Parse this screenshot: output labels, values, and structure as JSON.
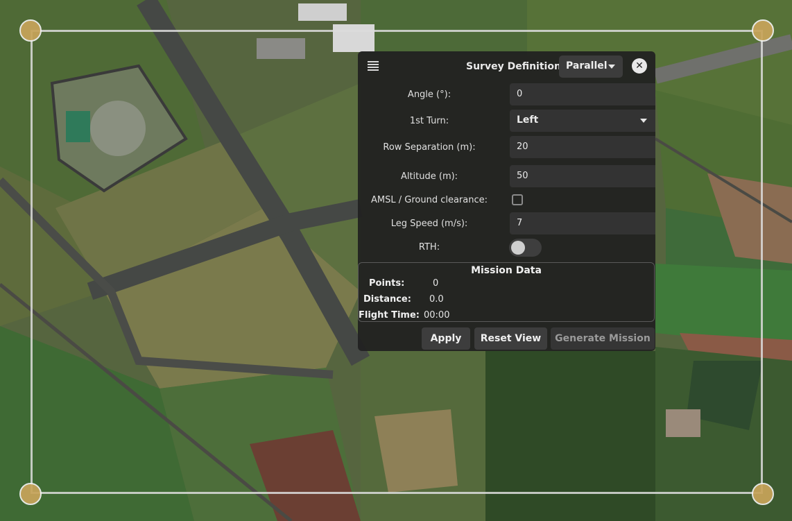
{
  "panel": {
    "title": "Survey Definition",
    "pattern_value": "Parallel",
    "close_glyph": "✕",
    "fields": {
      "angle_label": "Angle (°):",
      "angle_value": "0",
      "first_turn_label": "1st Turn:",
      "first_turn_value": "Left",
      "row_sep_label": "Row Separation (m):",
      "row_sep_value": "20",
      "altitude_label": "Altitude (m):",
      "altitude_value": "50",
      "amsl_label": "AMSL / Ground clearance:",
      "amsl_checked": false,
      "leg_speed_label": "Leg Speed (m/s):",
      "leg_speed_value": "7",
      "rth_label": "RTH:",
      "rth_on": false
    },
    "mission_data": {
      "title": "Mission Data",
      "points_label": "Points:",
      "points_value": "0",
      "distance_label": "Distance:",
      "distance_value": "0.0",
      "flight_time_label": "Flight Time:",
      "flight_time_value": "00:00"
    },
    "buttons": {
      "apply": "Apply",
      "reset_view": "Reset View",
      "generate_mission": "Generate Mission"
    }
  },
  "icons": {
    "menu": "menu-icon",
    "close": "close-icon",
    "dropdown": "chevron-down-icon",
    "handle": "vertex-handle-icon"
  },
  "colors": {
    "panel_bg": "#202020",
    "field_bg": "#333333",
    "handle_fill": "#c8a45a",
    "survey_outline": "#dcdcdc"
  }
}
